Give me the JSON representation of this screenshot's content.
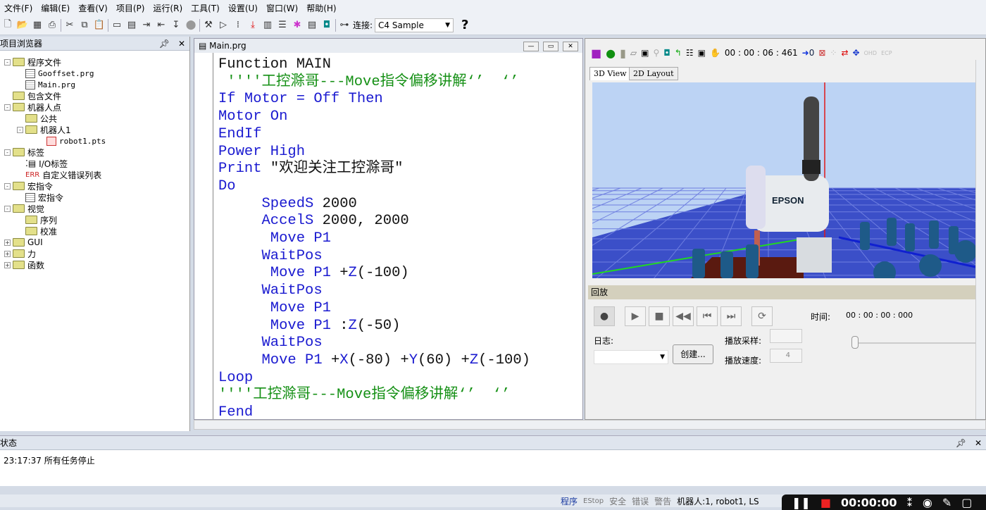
{
  "menu": [
    "文件(F)",
    "编辑(E)",
    "查看(V)",
    "项目(P)",
    "运行(R)",
    "工具(T)",
    "设置(U)",
    "窗口(W)",
    "帮助(H)"
  ],
  "toolbar": {
    "connect_label": "连接:",
    "connection": "C4 Sample",
    "help": "?"
  },
  "project_browser": {
    "title": "项目浏览器",
    "items": [
      {
        "label": "程序文件",
        "type": "folder",
        "level": 0,
        "toggle": "-"
      },
      {
        "label": "Gooffset.prg",
        "type": "file",
        "level": 1
      },
      {
        "label": "Main.prg",
        "type": "file",
        "level": 1
      },
      {
        "label": "包含文件",
        "type": "folder",
        "level": 0
      },
      {
        "label": "机器人点",
        "type": "folder",
        "level": 0,
        "toggle": "-"
      },
      {
        "label": "公共",
        "type": "folder",
        "level": 1
      },
      {
        "label": "机器人1",
        "type": "folder",
        "level": 1,
        "toggle": "-"
      },
      {
        "label": "robot1.pts",
        "type": "points",
        "level": 2
      },
      {
        "label": "标签",
        "type": "folder",
        "level": 0,
        "toggle": "-"
      },
      {
        "label": "I/O标签",
        "type": "io",
        "level": 1
      },
      {
        "label": "自定义错误列表",
        "type": "err",
        "level": 1,
        "badge": "ERR"
      },
      {
        "label": "宏指令",
        "type": "folder",
        "level": 0,
        "toggle": "-"
      },
      {
        "label": "宏指令",
        "type": "file",
        "level": 1
      },
      {
        "label": "视觉",
        "type": "folder",
        "level": 0,
        "toggle": "-"
      },
      {
        "label": "序列",
        "type": "folder",
        "level": 1
      },
      {
        "label": "校准",
        "type": "folder",
        "level": 1
      },
      {
        "label": "GUI",
        "type": "folder",
        "level": 0,
        "toggle": "+"
      },
      {
        "label": "力",
        "type": "folder",
        "level": 0,
        "toggle": "+"
      },
      {
        "label": "函数",
        "type": "folder",
        "level": 0,
        "toggle": "+"
      }
    ]
  },
  "editor": {
    "title": "Main.prg",
    "lines": [
      [
        [
          "Function MAIN",
          "f"
        ]
      ],
      [
        [
          " ''''工控滁哥---Move指令偏移讲解‘’  ‘’",
          "c"
        ]
      ],
      [
        [
          "If Motor = Off Then",
          "k"
        ]
      ],
      [
        [
          "Motor On",
          "k"
        ]
      ],
      [
        [
          "EndIf",
          "k"
        ]
      ],
      [
        [
          "Power High",
          "k"
        ]
      ],
      [
        [
          "Print ",
          "k"
        ],
        [
          "\"欢迎关注工控滁哥\"",
          "n"
        ]
      ],
      [
        [
          "Do",
          "k"
        ]
      ],
      [
        [
          "     SpeedS ",
          "k"
        ],
        [
          "2000",
          "n"
        ]
      ],
      [
        [
          "     AccelS ",
          "k"
        ],
        [
          "2000, 2000",
          "n"
        ]
      ],
      [
        [
          "      Move P1",
          "k"
        ]
      ],
      [
        [
          "     WaitPos",
          "k"
        ]
      ],
      [
        [
          "      Move P1 ",
          "k"
        ],
        [
          "+",
          "n"
        ],
        [
          "Z",
          "k"
        ],
        [
          "(-100)",
          "n"
        ]
      ],
      [
        [
          "     WaitPos",
          "k"
        ]
      ],
      [
        [
          "      Move P1",
          "k"
        ]
      ],
      [
        [
          "      Move P1 ",
          "k"
        ],
        [
          ":",
          "n"
        ],
        [
          "Z",
          "k"
        ],
        [
          "(-50)",
          "n"
        ]
      ],
      [
        [
          "     WaitPos",
          "k"
        ]
      ],
      [
        [
          "     Move P1 ",
          "k"
        ],
        [
          "+",
          "n"
        ],
        [
          "X",
          "k"
        ],
        [
          "(-80) +",
          "n"
        ],
        [
          "Y",
          "k"
        ],
        [
          "(60) +",
          "n"
        ],
        [
          "Z",
          "k"
        ],
        [
          "(-100)",
          "n"
        ]
      ],
      [
        [
          "Loop",
          "k"
        ]
      ],
      [
        [
          "''''工控滁哥---Move指令偏移讲解‘’  ‘’",
          "c"
        ]
      ],
      [
        [
          "Fend",
          "k"
        ]
      ]
    ]
  },
  "simulator": {
    "timer": "00 : 00 : 06 : 461",
    "counter": "0",
    "tabs": [
      "3D View",
      "2D Layout"
    ],
    "robot_brand": "EPSON",
    "playback": {
      "title": "回放",
      "time_label": "时间:",
      "time_value": "00 : 00 : 00 : 000",
      "log_label": "日志:",
      "create_button": "创建...",
      "sample_label": "播放采样:",
      "speed_label": "播放速度:",
      "speed_value": "4"
    }
  },
  "status": {
    "title": "状态",
    "message": "23:17:37 所有任务停止"
  },
  "statusbar": {
    "items": [
      "程序",
      "EStop",
      "安全",
      "错误",
      "警告",
      "机器人:1, robot1, LS"
    ]
  },
  "recorder": {
    "time": "00:00:00"
  },
  "colors": {
    "keyword": "#1a1ad0",
    "comment": "#159015",
    "floor": "#3b4fc8"
  }
}
